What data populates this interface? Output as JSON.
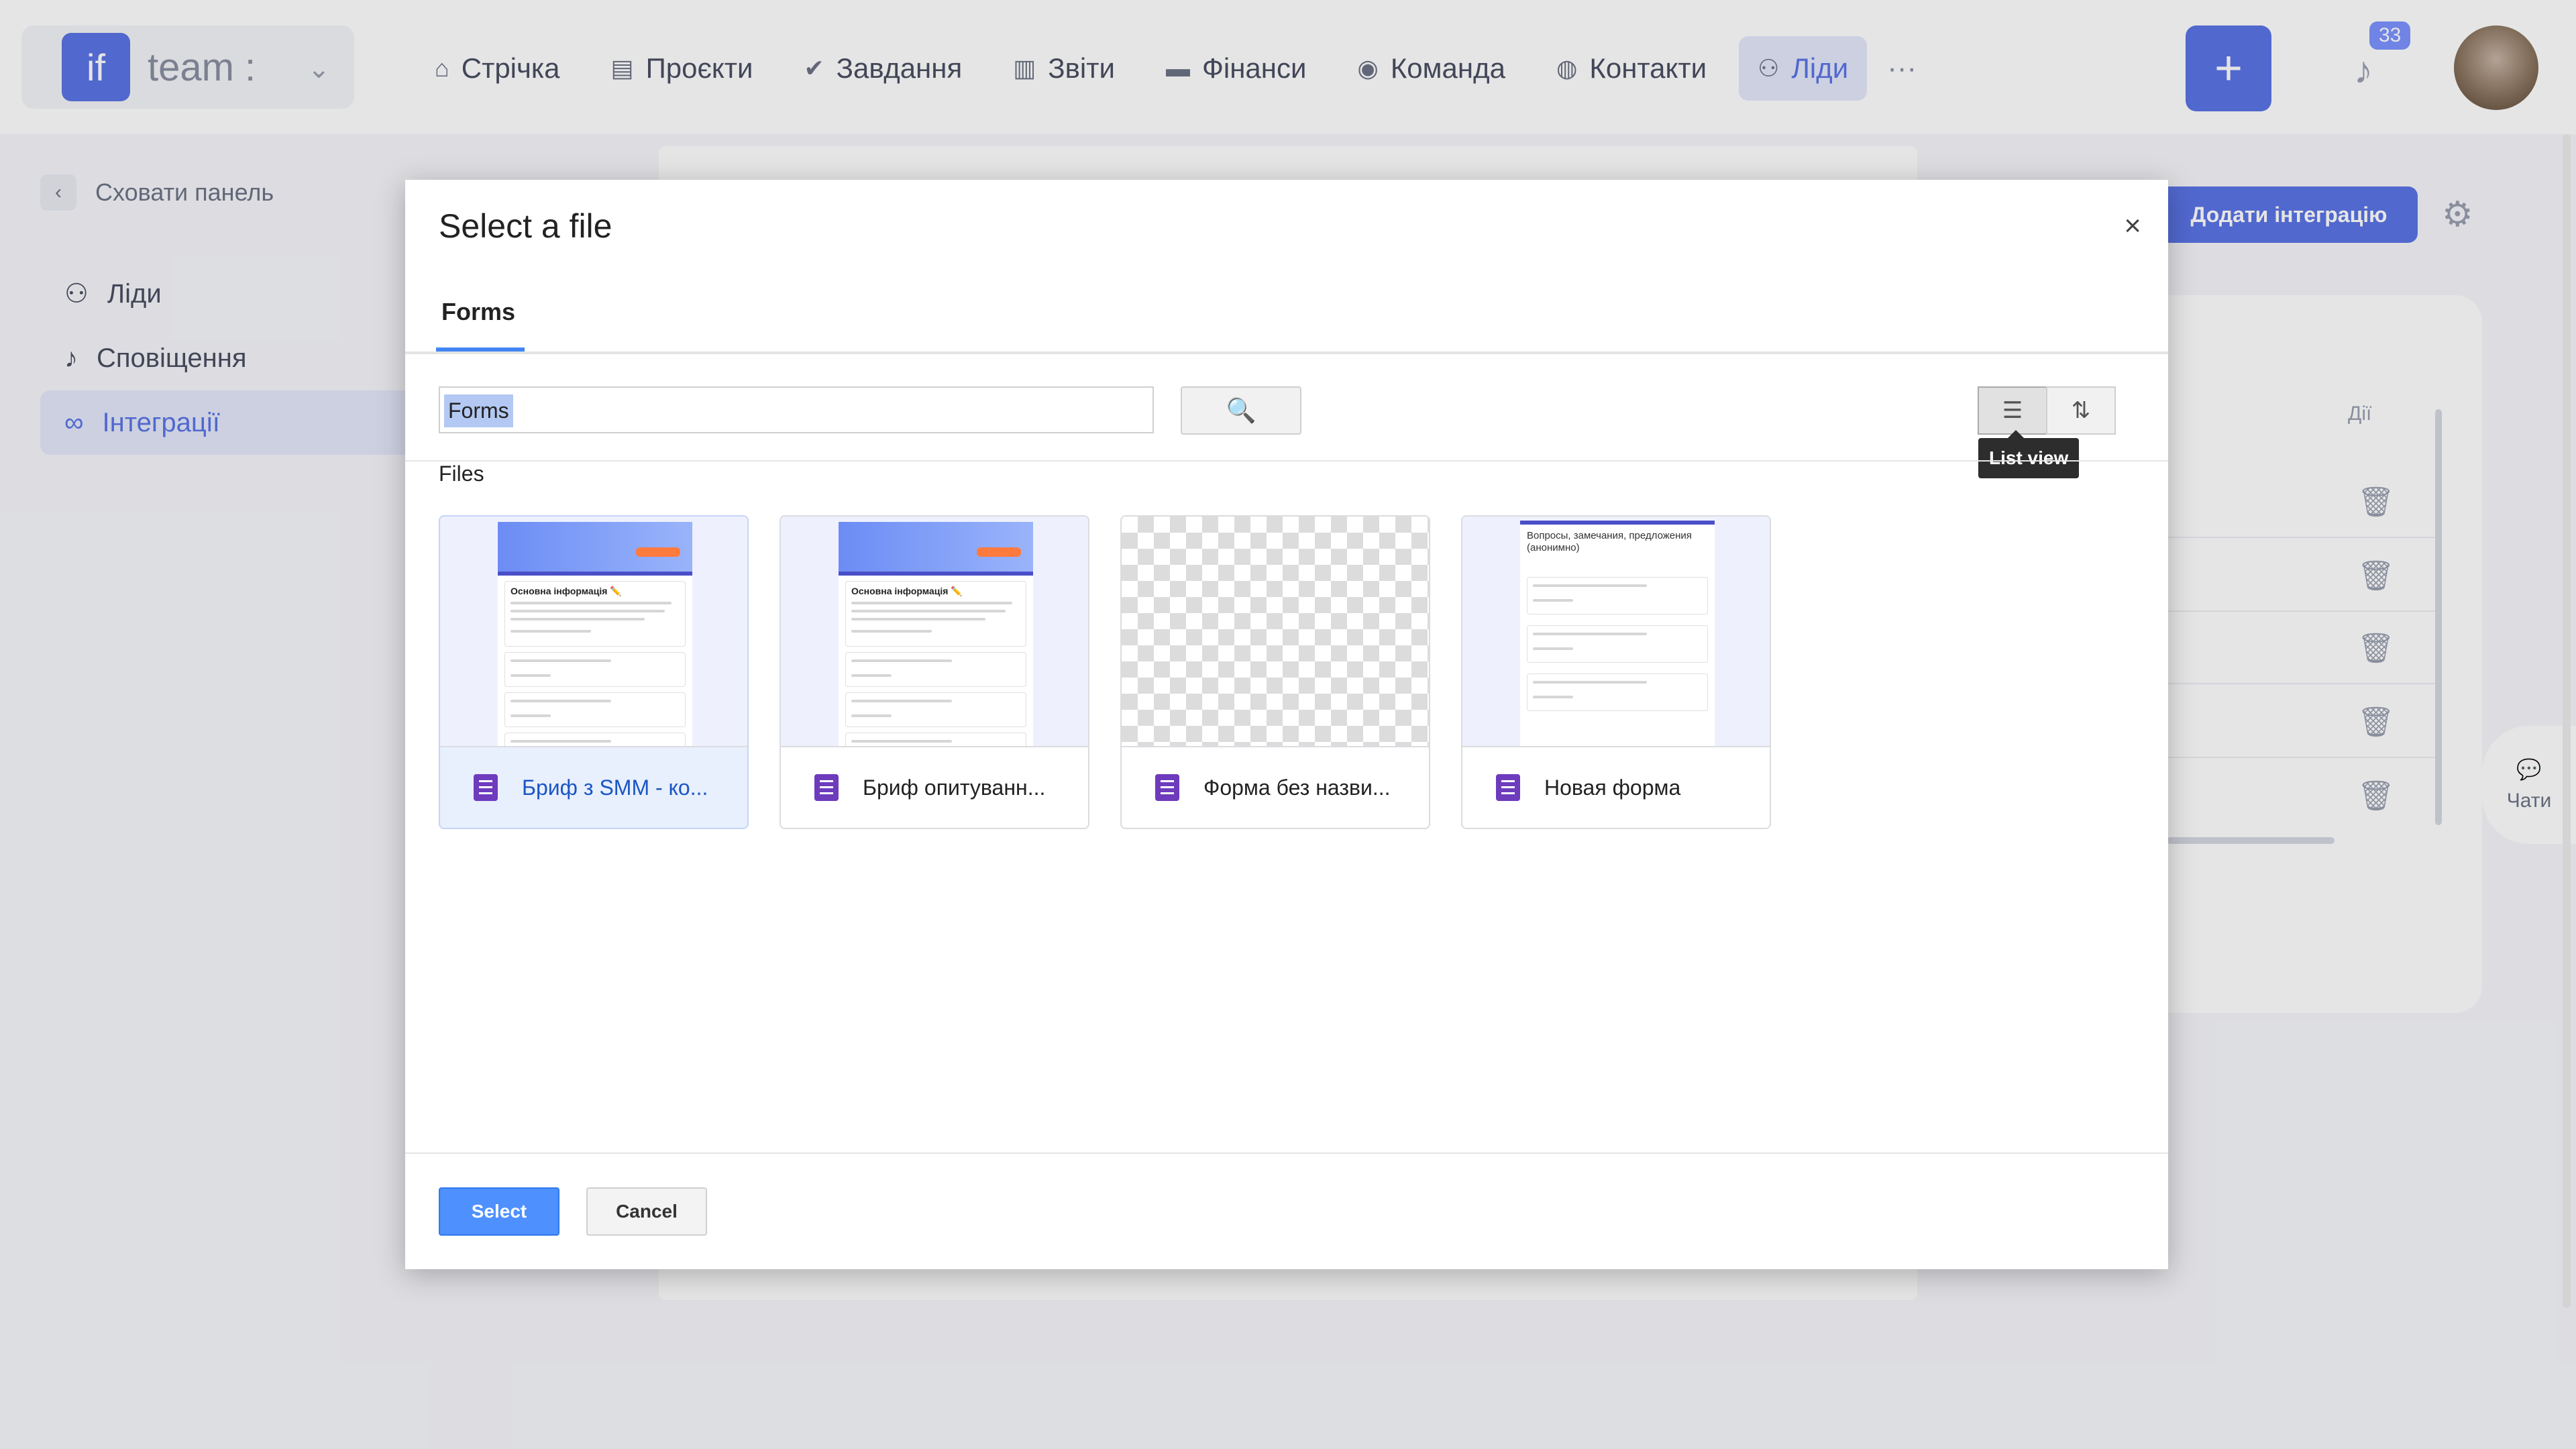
{
  "app": {
    "brand": {
      "logo": "if",
      "name": "team :"
    },
    "nav": [
      {
        "label": "Стрічка",
        "icon": "home-icon",
        "glyph": "⌂"
      },
      {
        "label": "Проєкти",
        "icon": "file-icon",
        "glyph": "▤"
      },
      {
        "label": "Завдання",
        "icon": "check-circle-icon",
        "glyph": "✔"
      },
      {
        "label": "Звіти",
        "icon": "report-icon",
        "glyph": "▥"
      },
      {
        "label": "Фінанси",
        "icon": "wallet-icon",
        "glyph": "▬"
      },
      {
        "label": "Команда",
        "icon": "user-icon",
        "glyph": "◉"
      },
      {
        "label": "Контакти",
        "icon": "contacts-icon",
        "glyph": "◍"
      },
      {
        "label": "Ліди",
        "icon": "leads-icon",
        "glyph": "⚇",
        "active": true
      }
    ],
    "more": "···",
    "notification_count": "33",
    "sidebar": {
      "hide_panel": "Сховати панель",
      "items": [
        {
          "label": "Ліди",
          "icon": "leads-icon",
          "glyph": "⚇"
        },
        {
          "label": "Сповіщення",
          "icon": "bell-icon",
          "glyph": "♪"
        },
        {
          "label": "Інтеграції",
          "icon": "link-icon",
          "glyph": "∞",
          "active": true
        }
      ]
    },
    "add_integration": "Додати інтеграцію",
    "column_head": "Дії",
    "chat_label": "Чати"
  },
  "dialog": {
    "title": "Select a file",
    "close": "×",
    "tab": "Forms",
    "search_value": "Forms",
    "list_view_tooltip": "List view",
    "files_label": "Files",
    "files": [
      {
        "name": "Бриф з SMM - ко...",
        "thumb": "form-brief",
        "selected": true
      },
      {
        "name": "Бриф опитуванн...",
        "thumb": "form-brief"
      },
      {
        "name": "Форма без назви...",
        "thumb": "empty"
      },
      {
        "name": "Новая форма",
        "thumb": "feedback"
      }
    ],
    "feedback_thumb_title": "Вопросы, замечания, предложения (анонимно)",
    "brief_section_title": "Основна інформація ✏️",
    "select_label": "Select",
    "cancel_label": "Cancel"
  },
  "colors": {
    "accent": "#5b74e6",
    "google_blue": "#4d90fe",
    "forms_purple": "#6e3bbd"
  }
}
